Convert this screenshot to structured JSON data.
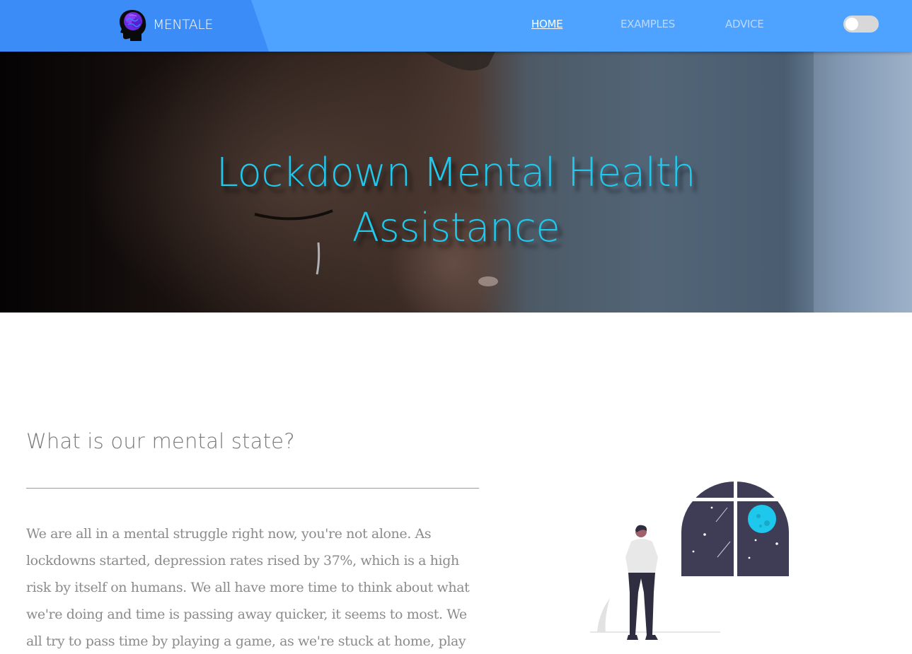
{
  "navbar": {
    "brand_name": "MENTALE",
    "links": [
      {
        "label": "HOME",
        "active": true
      },
      {
        "label": "EXAMPLES",
        "active": false
      },
      {
        "label": "ADVICE",
        "active": false
      }
    ],
    "theme_toggle": {
      "state": "off"
    },
    "colors": {
      "bar": "#4da3ff",
      "brand_panel": "#3b8cf7"
    }
  },
  "hero": {
    "title_line1": "Lockdown Mental Health",
    "title_line2": "Assistance",
    "title_color": "#1fc8ec"
  },
  "content": {
    "heading": "What is our mental state?",
    "paragraph": "We are all in a mental struggle right now, you're not alone. As lockdowns started, depression rates rised by 37%, which is a high risk by itself on humans. We all have more time to think about what we're doing and time is passing away quicker, it seems to most. We all try to pass time by playing a game, as we're stuck at home, play with friends or be with our"
  },
  "icons": {
    "brand_logo": "head-brain-icon",
    "illustration": "person-at-night-window-illustration"
  }
}
